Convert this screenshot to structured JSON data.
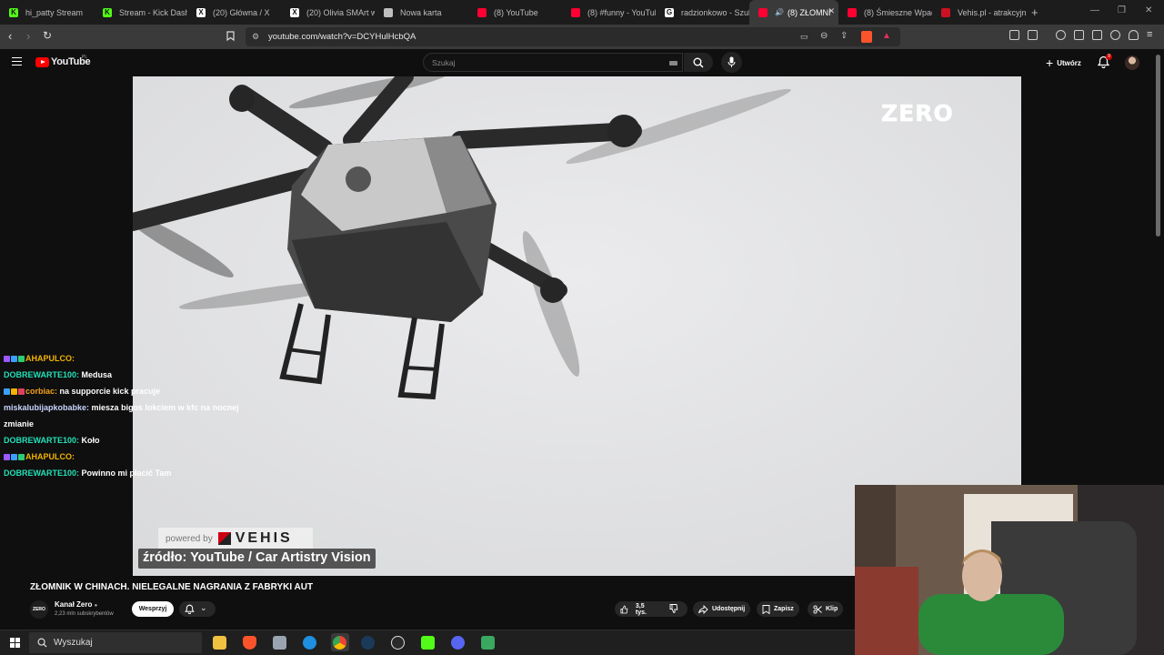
{
  "browser": {
    "tabs": [
      {
        "label": "hi_patty Stream",
        "color": "#53fc18",
        "glyph": "K",
        "active": false
      },
      {
        "label": "Stream - Kick Dashb",
        "color": "#53fc18",
        "glyph": "K",
        "active": false
      },
      {
        "label": "(20) Główna / X",
        "color": "#ffffff",
        "glyph": "X",
        "active": false
      },
      {
        "label": "(20) Olivia SMArt w",
        "color": "#ffffff",
        "glyph": "X",
        "active": false
      },
      {
        "label": "Nowa karta",
        "color": "#bfbfbf",
        "glyph": "",
        "active": false
      },
      {
        "label": "(8) YouTube",
        "color": "#ff0033",
        "glyph": "",
        "active": false
      },
      {
        "label": "(8) #funny - YouTub",
        "color": "#ff0033",
        "glyph": "",
        "active": false
      },
      {
        "label": "radzionkowo - Szuk",
        "color": "#ffffff",
        "glyph": "G",
        "active": false
      },
      {
        "label": "(8) ZŁOMNI",
        "color": "#ff0033",
        "glyph": "",
        "active": true
      },
      {
        "label": "(8) Śmieszne Wpad",
        "color": "#ff0033",
        "glyph": "",
        "active": false
      },
      {
        "label": "Vehis.pl - atrakcyjn",
        "color": "#cc1122",
        "glyph": "",
        "active": false
      }
    ],
    "new_tab": "+",
    "url": "youtube.com/watch?v=DCYHulHcbQA"
  },
  "youtube": {
    "logo_text": "YouTube",
    "country_code": "PL",
    "search_placeholder": "Szukaj",
    "create_label": "Utwórz",
    "notification_count": "9",
    "video_overlay": {
      "channel_watermark": "ZERO",
      "powered_by": "powered by",
      "sponsor": "VEHIS",
      "source_caption": "źródło: YouTube / Car Artistry Vision"
    },
    "video_title": "ZŁOMNIK W CHINACH. NIELEGALNE NAGRANIA Z FABRYKI AUT",
    "channel": {
      "avatar_text": "ZERO",
      "name": "Kanał Zero",
      "subscribers": "2,23 mln subskrybentów",
      "support_label": "Wesprzyj"
    },
    "actions": {
      "likes": "3,5 tys.",
      "share": "Udostępnij",
      "save": "Zapisz",
      "clip": "Klip"
    }
  },
  "chat": [
    {
      "user": "AHAPULCO:",
      "user_color": "#f2b400",
      "text": "",
      "badges": [
        "#9b59ff",
        "#3aa0ff",
        "#2ecc71"
      ]
    },
    {
      "user": "DOBREWARTE100:",
      "user_color": "#22e0b8",
      "text": "Medusa",
      "badges": []
    },
    {
      "user": "corbiac:",
      "user_color": "#f2a01b",
      "text": "na supporcie kick pracuje",
      "badges": [
        "#3aa0ff",
        "#f2b400",
        "#e04060"
      ]
    },
    {
      "user": "miskalubijapkobabke:",
      "user_color": "#c9d4ff",
      "text": "miesza bigos lokciem w kfc na nocnej zmianie",
      "badges": []
    },
    {
      "user": "DOBREWARTE100:",
      "user_color": "#22e0b8",
      "text": "Koło",
      "badges": []
    },
    {
      "user": "AHAPULCO:",
      "user_color": "#f2b400",
      "text": "",
      "badges": [
        "#9b59ff",
        "#3aa0ff",
        "#2ecc71"
      ]
    },
    {
      "user": "DOBREWARTE100:",
      "user_color": "#22e0b8",
      "text": "Powinno mi płacić Tam",
      "badges": []
    }
  ],
  "taskbar": {
    "search_label": "Wyszukaj"
  }
}
